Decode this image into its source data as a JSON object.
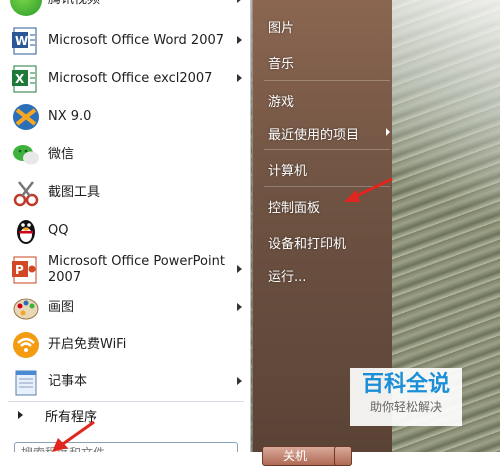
{
  "left_items": [
    {
      "label": "腾讯视频",
      "icon": "tencent-video-icon",
      "submenu": true
    },
    {
      "label": "Microsoft Office Word 2007",
      "icon": "word-icon",
      "submenu": true
    },
    {
      "label": "Microsoft Office excl2007",
      "icon": "excel-icon",
      "submenu": true
    },
    {
      "label": "NX 9.0",
      "icon": "nx-icon",
      "submenu": false
    },
    {
      "label": "微信",
      "icon": "wechat-icon",
      "submenu": false
    },
    {
      "label": "截图工具",
      "icon": "scissors-icon",
      "submenu": false
    },
    {
      "label": "QQ",
      "icon": "qq-penguin-icon",
      "submenu": false
    },
    {
      "label": "Microsoft Office PowerPoint 2007",
      "icon": "powerpoint-icon",
      "submenu": true
    },
    {
      "label": "画图",
      "icon": "paint-icon",
      "submenu": true
    },
    {
      "label": "开启免费WiFi",
      "icon": "wifi-icon",
      "submenu": false
    },
    {
      "label": "记事本",
      "icon": "notepad-icon",
      "submenu": true
    }
  ],
  "all_programs": "所有程序",
  "search_placeholder": "搜索程序和文件",
  "right_items": [
    {
      "label": "图片",
      "submenu": false
    },
    {
      "label": "音乐",
      "submenu": false
    },
    {
      "label": "游戏",
      "submenu": false
    },
    {
      "label": "最近使用的项目",
      "submenu": true
    },
    {
      "label": "计算机",
      "submenu": false
    },
    {
      "label": "控制面板",
      "submenu": false
    },
    {
      "label": "设备和打印机",
      "submenu": false
    },
    {
      "label": "运行...",
      "submenu": false
    }
  ],
  "shutdown_label": "关机",
  "watermark": {
    "title": "百科全说",
    "subtitle": "助你轻松解决"
  },
  "colors": {
    "accent_red": "#e0261e",
    "watermark_blue": "#1a8fd8"
  }
}
